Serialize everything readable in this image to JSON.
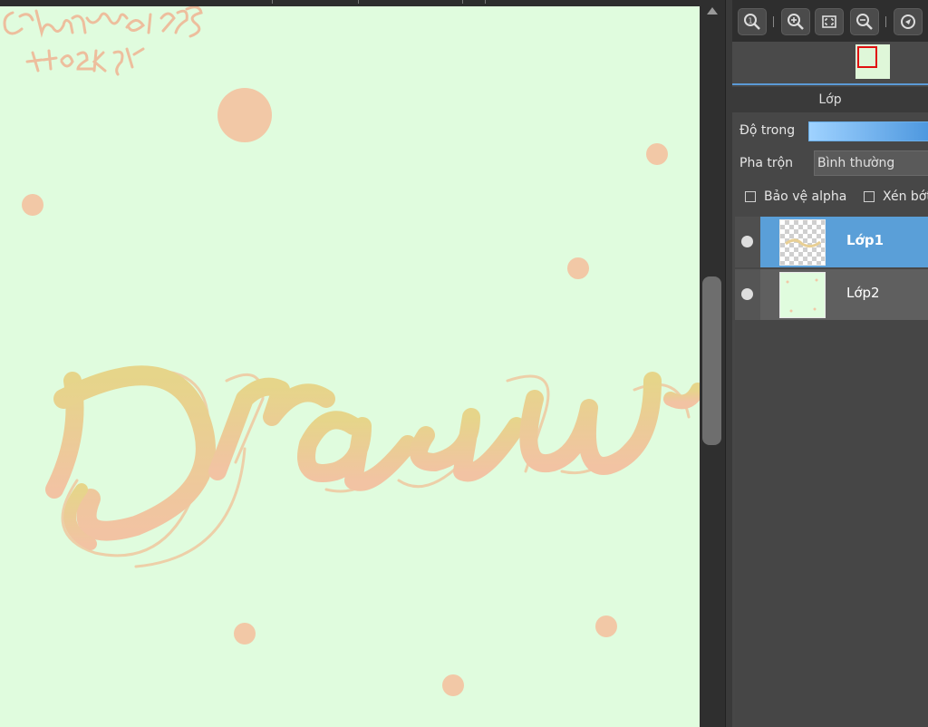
{
  "layers_panel": {
    "title": "Lớp",
    "opacity_label": "Độ trong",
    "blend_label": "Pha trộn",
    "blend_value": "Bình thường",
    "protect_alpha_label": "Bảo vệ alpha",
    "clipping_label": "Xén bớt",
    "layers": [
      {
        "name": "Lớp1",
        "selected": true,
        "visible": true
      },
      {
        "name": "Lớp2",
        "selected": false,
        "visible": true
      }
    ]
  },
  "toolbar": {
    "icons": [
      "zoom-actual-icon",
      "zoom-in-icon",
      "fit-screen-icon",
      "zoom-out-icon",
      "rotate-icon"
    ]
  },
  "canvas": {
    "background": "#e0fcde",
    "artwork_text": "Draw",
    "signature": "@lamma1985 #+to 2k1"
  },
  "colors": {
    "accent": "#5a9fd8",
    "panel_bg": "#474747",
    "dot_color": "#f2c8a6",
    "lettering_top": "#e6d58a",
    "lettering_bottom": "#f2c3a3"
  }
}
